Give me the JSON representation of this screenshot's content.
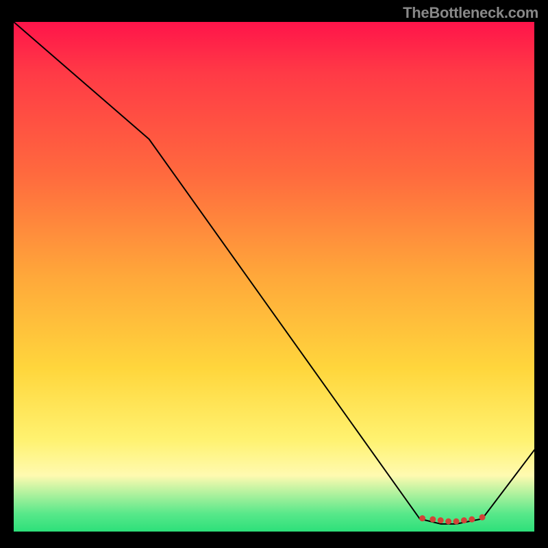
{
  "watermark": "TheBottleneck.com",
  "chart_data": {
    "type": "line",
    "title": "",
    "xlabel": "",
    "ylabel": "",
    "xlim": [
      0,
      100
    ],
    "ylim": [
      0,
      100
    ],
    "grid": false,
    "legend": false,
    "series": [
      {
        "name": "curve",
        "x": [
          0,
          26,
          78,
          82,
          85,
          90,
          100
        ],
        "values": [
          100,
          77,
          2.5,
          1.5,
          1.5,
          2.5,
          16
        ],
        "stroke": "#000000",
        "stroke_width": 2
      }
    ],
    "markers": [
      {
        "name": "dot-1",
        "x": 78.5,
        "y": 2.6,
        "r": 4.5,
        "fill": "#d14438"
      },
      {
        "name": "dot-2",
        "x": 80.5,
        "y": 2.4,
        "r": 4.5,
        "fill": "#d14438"
      },
      {
        "name": "dot-3",
        "x": 82.0,
        "y": 2.2,
        "r": 4.5,
        "fill": "#d14438"
      },
      {
        "name": "dot-4",
        "x": 83.5,
        "y": 2.0,
        "r": 4.5,
        "fill": "#d14438"
      },
      {
        "name": "dot-5",
        "x": 85.0,
        "y": 2.0,
        "r": 4.5,
        "fill": "#d14438"
      },
      {
        "name": "dot-6",
        "x": 86.5,
        "y": 2.2,
        "r": 4.5,
        "fill": "#d14438"
      },
      {
        "name": "dot-7",
        "x": 88.0,
        "y": 2.4,
        "r": 4.5,
        "fill": "#d14438"
      },
      {
        "name": "dot-8",
        "x": 90.0,
        "y": 2.8,
        "r": 4.5,
        "fill": "#d14438"
      }
    ]
  }
}
